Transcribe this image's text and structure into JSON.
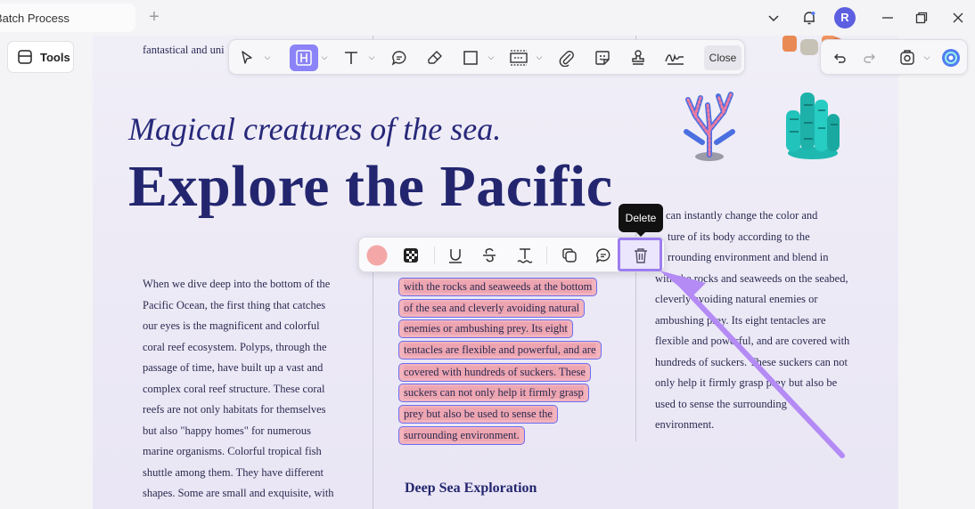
{
  "titlebar": {
    "tab_label": "Batch Process",
    "new_tab": "+",
    "avatar_letter": "R"
  },
  "sidebar": {
    "tools_label": "Tools"
  },
  "toolbar": {
    "close_label": "Close"
  },
  "document": {
    "top_line": "fantastical and uni",
    "subtitle": "Magical creatures of the sea.",
    "title": "Explore the Pacific",
    "column1": [
      "When we dive deep into the bottom of the",
      "Pacific Ocean, the first thing that catches",
      "our eyes is the magnificent and colorful",
      "coral reef ecosystem. Polyps, through the",
      "passage of time, have built up a vast and",
      "complex coral reef structure. These coral",
      "reefs are not only habitats for themselves",
      "but also \"happy homes\" for numerous",
      "marine organisms. Colorful tropical fish",
      "shuttle among them. They have different",
      "shapes. Some are small and exquisite, with"
    ],
    "column2_highlighted": [
      "with the rocks and seaweeds at the bottom",
      "of the sea and cleverly avoiding natural",
      "enemies or ambushing prey. Its eight",
      "tentacles are flexible and powerful, and are",
      "covered with hundreds of suckers. These",
      "suckers can not only help it firmly grasp",
      "prey but also be used to sense the",
      "surrounding environment."
    ],
    "column3": [
      "can instantly change the color and",
      "ture of its body according to the",
      "rrounding environment and blend in",
      "with the rocks and seaweeds on the seabed,",
      "cleverly avoiding natural enemies or",
      "ambushing prey. Its eight tentacles are",
      "flexible and powerful, and are covered with",
      "hundreds of suckers. These suckers can not",
      "only help it firmly grasp prey but also be",
      "used to sense the surrounding",
      "environment."
    ],
    "subheading": "Deep Sea Exploration"
  },
  "annotation_toolbar": {
    "highlight_color": "#f4a7a7",
    "tooltip": "Delete"
  },
  "colors": {
    "accent": "#8b83f7",
    "title_navy": "#23266f",
    "highlight_border": "#6b6ef0",
    "highlight_fill": "#f2b3bd",
    "arrow": "#b48af5"
  }
}
